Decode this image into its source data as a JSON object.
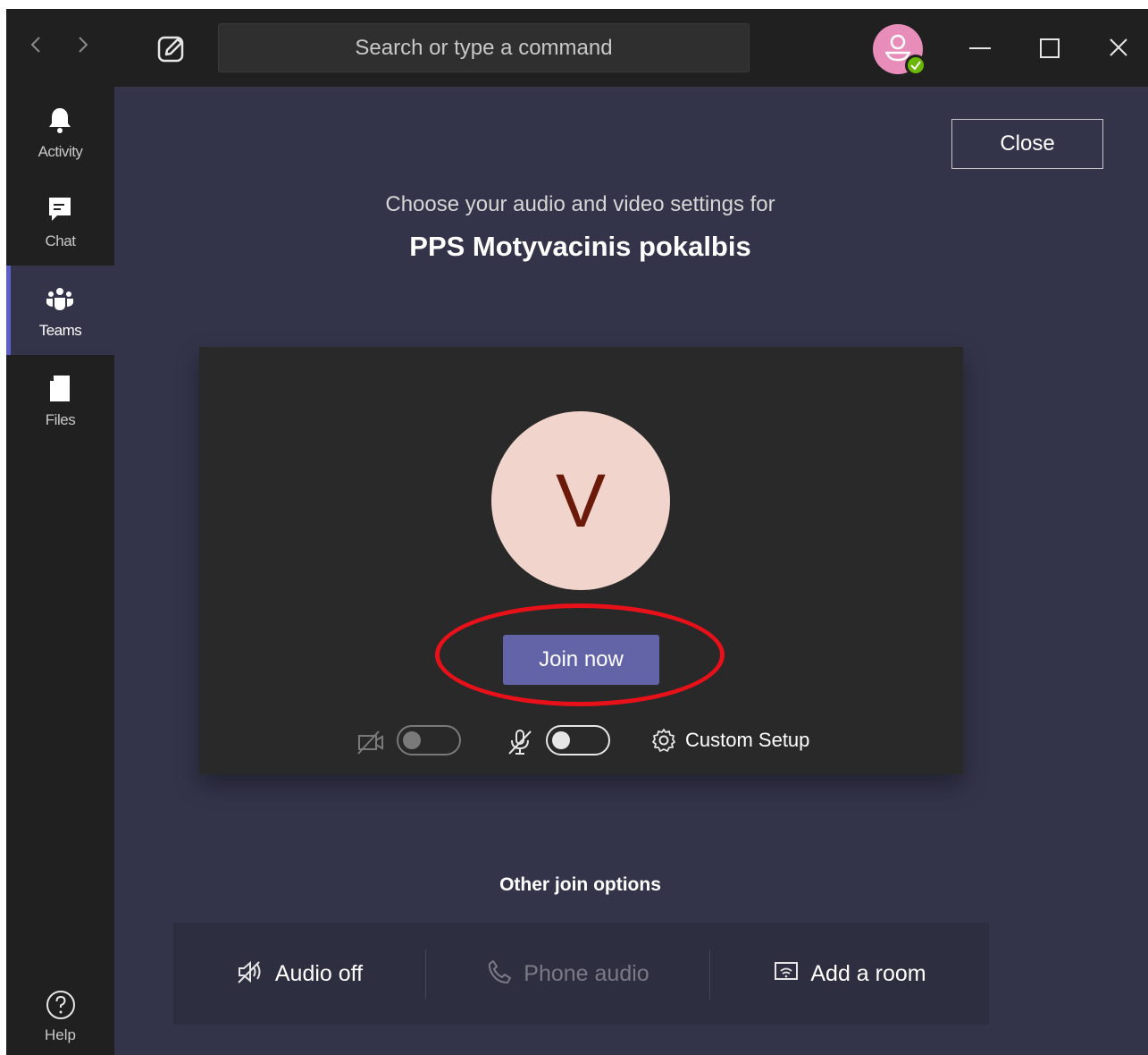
{
  "titlebar": {
    "search_placeholder": "Search or type a command"
  },
  "rail": {
    "items": [
      {
        "label": "Activity",
        "icon": "bell-icon"
      },
      {
        "label": "Chat",
        "icon": "chat-icon"
      },
      {
        "label": "Teams",
        "icon": "teams-icon",
        "active": true
      },
      {
        "label": "Files",
        "icon": "file-icon"
      }
    ],
    "help_label": "Help"
  },
  "main": {
    "close_label": "Close",
    "subtitle": "Choose your audio and video settings for",
    "meeting_title": "PPS Motyvacinis pokalbis",
    "avatar_initial": "V",
    "join_label": "Join now",
    "video_toggle": "off",
    "mic_toggle": "off",
    "custom_setup_label": "Custom Setup",
    "other_title": "Other join options",
    "options": {
      "audio_off": "Audio off",
      "phone_audio": "Phone audio",
      "add_room": "Add a room"
    }
  },
  "colors": {
    "accent": "#6264a7",
    "highlight": "#e8111a",
    "presence": "#6bb700",
    "avatar_bg": "#f1d4cb"
  }
}
